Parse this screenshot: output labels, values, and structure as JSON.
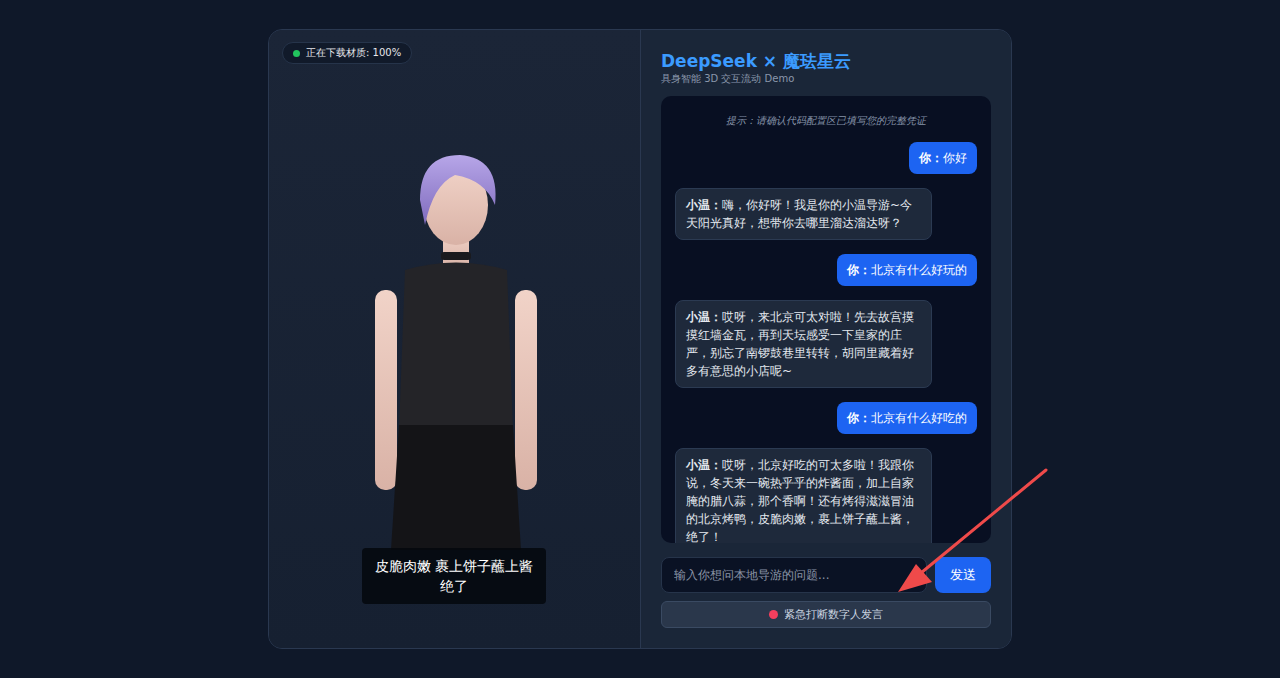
{
  "header": {
    "title": "DeepSeek × 魔珐星云",
    "subtitle": "具身智能 3D 交互流动 Demo"
  },
  "status_badge": {
    "text": "正在下载材质: 100%"
  },
  "caption": "皮脆肉嫩 裹上饼子蘸上酱 绝了",
  "chat": {
    "hint": "提示：请确认代码配置区已填写您的完整凭证",
    "messages": [
      {
        "kind": "user",
        "speaker": "你：",
        "text": "你好"
      },
      {
        "kind": "bot",
        "speaker": "小温：",
        "text": "嗨，你好呀！我是你的小温导游~今天阳光真好，想带你去哪里溜达溜达呀？"
      },
      {
        "kind": "user",
        "speaker": "你：",
        "text": "北京有什么好玩的"
      },
      {
        "kind": "bot",
        "speaker": "小温：",
        "text": "哎呀，来北京可太对啦！先去故宫摸摸红墙金瓦，再到天坛感受一下皇家的庄严，别忘了南锣鼓巷里转转，胡同里藏着好多有意思的小店呢~"
      },
      {
        "kind": "user",
        "speaker": "你：",
        "text": "北京有什么好吃的"
      },
      {
        "kind": "bot",
        "speaker": "小温：",
        "text": "哎呀，北京好吃的可太多啦！我跟你说，冬天来一碗热乎乎的炸酱面，加上自家腌的腊八蒜，那个香啊！还有烤得滋滋冒油的北京烤鸭，皮脆肉嫩，裹上饼子蘸上酱，绝了！"
      }
    ]
  },
  "input": {
    "placeholder": "输入你想问本地导游的问题..."
  },
  "send_button": {
    "label": "发送"
  },
  "interrupt_button": {
    "label": "紧急打断数字人发言"
  }
}
